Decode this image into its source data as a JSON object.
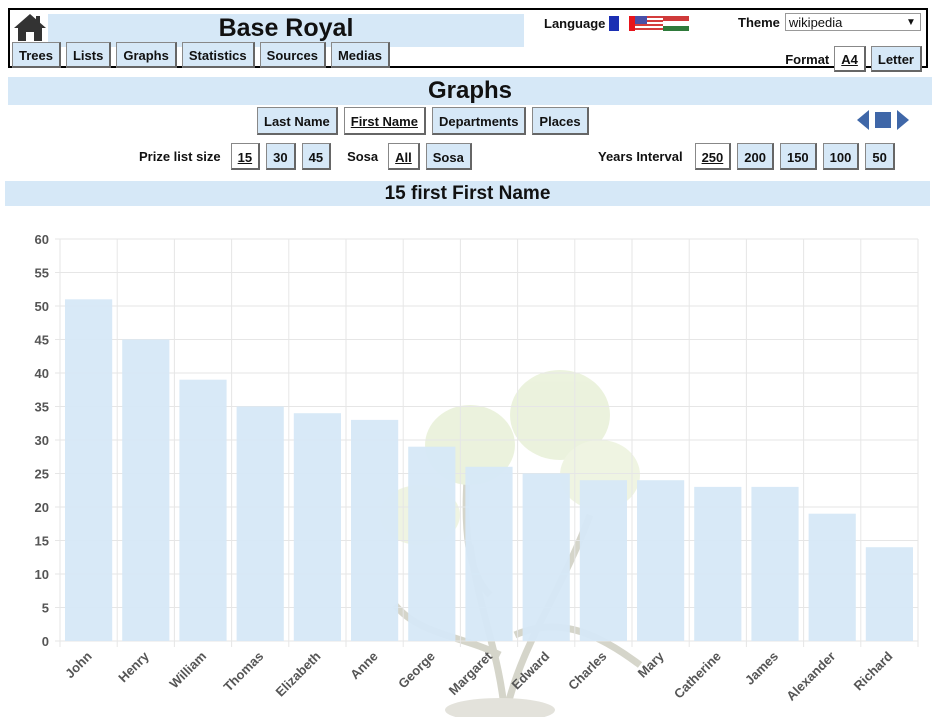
{
  "header": {
    "title": "Base Royal",
    "nav": [
      "Trees",
      "Lists",
      "Graphs",
      "Statistics",
      "Sources",
      "Medias"
    ],
    "language_label": "Language",
    "languages": [
      "French",
      "English",
      "Hungarian"
    ],
    "theme_label": "Theme",
    "theme_value": "wikipedia",
    "format_label": "Format",
    "formats": [
      {
        "label": "A4",
        "active": true
      },
      {
        "label": "Letter",
        "active": false
      }
    ]
  },
  "page": {
    "title": "Graphs",
    "graph_types": [
      {
        "label": "Last Name",
        "active": false
      },
      {
        "label": "First Name",
        "active": true
      },
      {
        "label": "Departments",
        "active": false
      },
      {
        "label": "Places",
        "active": false
      }
    ],
    "prize_label": "Prize list size",
    "prize_sizes": [
      {
        "label": "15",
        "active": true
      },
      {
        "label": "30",
        "active": false
      },
      {
        "label": "45",
        "active": false
      }
    ],
    "sosa_label": "Sosa",
    "sosa_options": [
      {
        "label": "All",
        "active": true
      },
      {
        "label": "Sosa",
        "active": false
      }
    ],
    "years_label": "Years Interval",
    "years_options": [
      {
        "label": "250",
        "active": true
      },
      {
        "label": "200",
        "active": false
      },
      {
        "label": "150",
        "active": false
      },
      {
        "label": "100",
        "active": false
      },
      {
        "label": "50",
        "active": false
      }
    ],
    "subtitle": "15 first First Name"
  },
  "colors": {
    "bar": "#d6e8f7",
    "band": "#d6e8f7",
    "nav_arrow": "#3f67a8"
  },
  "chart_data": {
    "type": "bar",
    "title": "15 first First Name",
    "xlabel": "",
    "ylabel": "",
    "categories": [
      "John",
      "Henry",
      "William",
      "Thomas",
      "Elizabeth",
      "Anne",
      "George",
      "Margaret",
      "Edward",
      "Charles",
      "Mary",
      "Catherine",
      "James",
      "Alexander",
      "Richard"
    ],
    "values": [
      51,
      45,
      39,
      35,
      34,
      33,
      29,
      26,
      25,
      24,
      24,
      23,
      23,
      19,
      14
    ],
    "ylim": [
      0,
      60
    ],
    "yticks": [
      0,
      5,
      10,
      15,
      20,
      25,
      30,
      35,
      40,
      45,
      50,
      55,
      60
    ],
    "grid": true,
    "legend": "none"
  }
}
